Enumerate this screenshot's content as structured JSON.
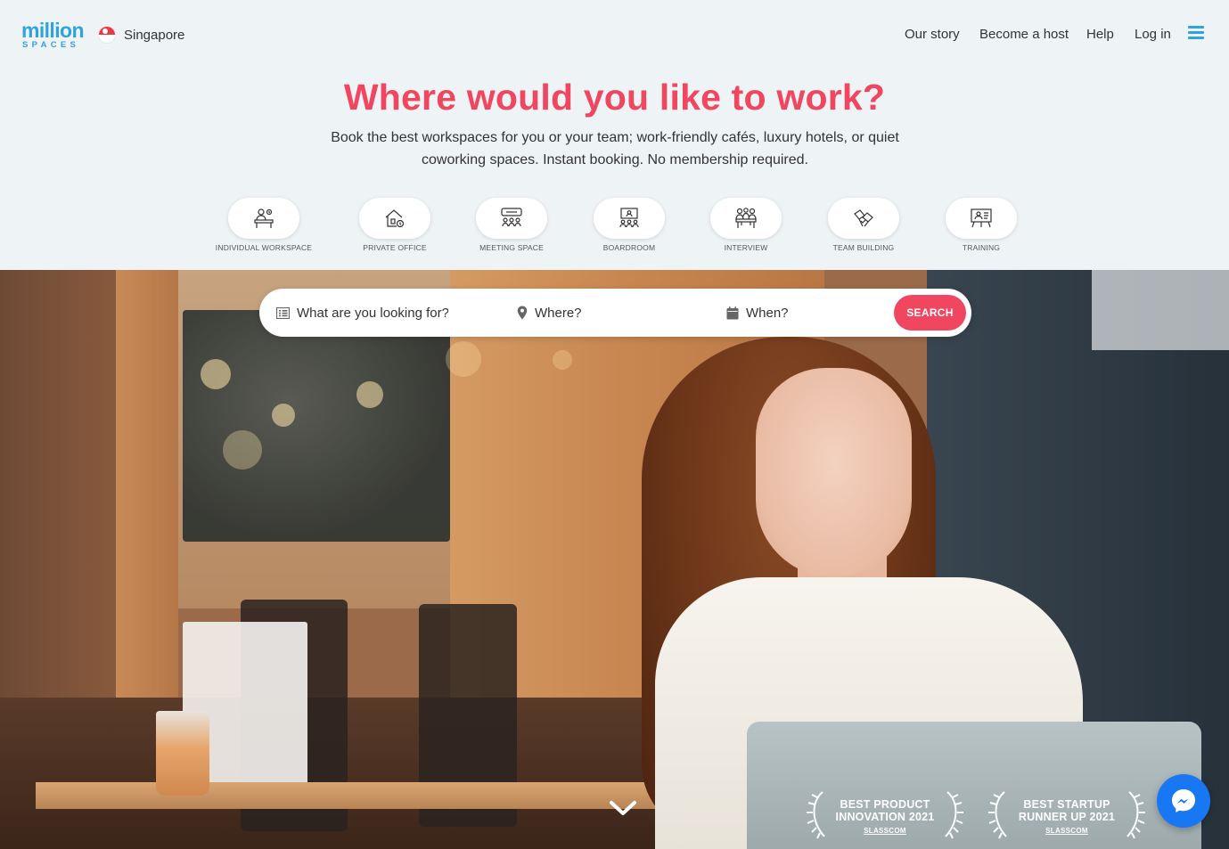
{
  "header": {
    "logo_top": "million",
    "logo_bottom": "SPACES",
    "country": "Singapore",
    "nav": {
      "our_story": "Our story",
      "become_host": "Become a host",
      "help": "Help",
      "log_in": "Log in"
    }
  },
  "hero": {
    "title": "Where would you like to work?",
    "subtitle": "Book the best workspaces for you or your team; work-friendly cafés, luxury hotels, or quiet coworking spaces. Instant booking. No membership required."
  },
  "categories": [
    {
      "label": "INDIVIDUAL WORKSPACE",
      "icon": "individual-workspace-icon"
    },
    {
      "label": "PRIVATE OFFICE",
      "icon": "private-office-icon"
    },
    {
      "label": "MEETING SPACE",
      "icon": "meeting-space-icon"
    },
    {
      "label": "BOARDROOM",
      "icon": "boardroom-icon"
    },
    {
      "label": "INTERVIEW",
      "icon": "interview-icon"
    },
    {
      "label": "TEAM BUILDING",
      "icon": "team-building-icon"
    },
    {
      "label": "TRAINING",
      "icon": "training-icon"
    }
  ],
  "search": {
    "what_placeholder": "What are you looking for?",
    "where_placeholder": "Where?",
    "when_placeholder": "When?",
    "button_label": "SEARCH"
  },
  "awards": [
    {
      "line1": "BEST PRODUCT",
      "line2": "INNOVATION 2021",
      "brand": "SLASSCOM"
    },
    {
      "line1": "BEST STARTUP",
      "line2": "RUNNER UP 2021",
      "brand": "SLASSCOM"
    }
  ],
  "colors": {
    "accent": "#f0465f",
    "brand_blue": "#2ea3dc",
    "messenger": "#1877f2"
  }
}
